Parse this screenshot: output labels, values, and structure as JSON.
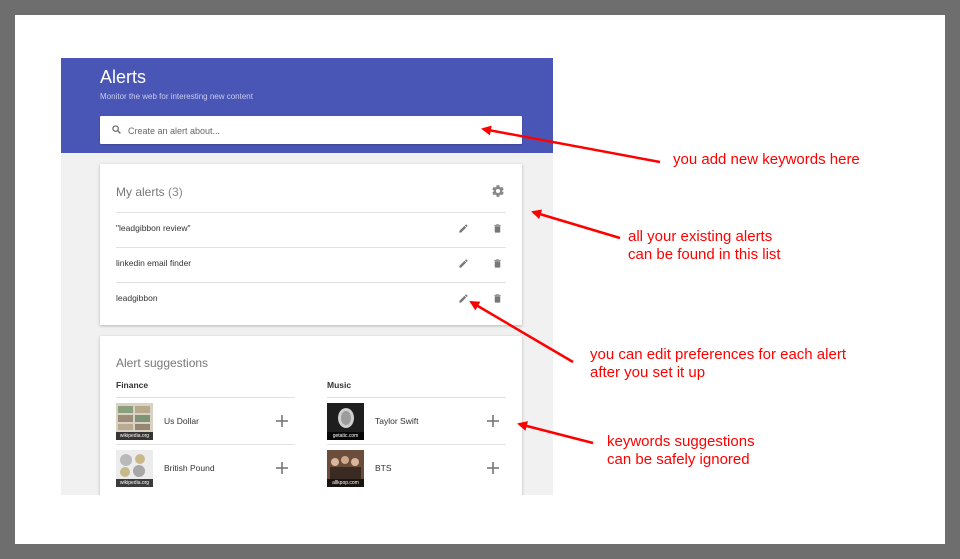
{
  "header": {
    "title": "Alerts",
    "subtitle": "Monitor the web for interesting new content"
  },
  "search": {
    "placeholder": "Create an alert about..."
  },
  "my_alerts": {
    "title": "My alerts",
    "count": "(3)",
    "items": [
      {
        "label": "\"leadgibbon review\""
      },
      {
        "label": "linkedin email finder"
      },
      {
        "label": "leadgibbon"
      }
    ]
  },
  "suggestions": {
    "title": "Alert suggestions",
    "columns": [
      {
        "title": "Finance",
        "items": [
          {
            "name": "Us Dollar",
            "source": "wikipedia.org"
          },
          {
            "name": "British Pound",
            "source": "wikipedia.org"
          }
        ]
      },
      {
        "title": "Music",
        "items": [
          {
            "name": "Taylor Swift",
            "source": "getatic.com"
          },
          {
            "name": "BTS",
            "source": "allkpop.com"
          }
        ]
      }
    ]
  },
  "annotations": {
    "a1": "you add new keywords here",
    "a2_line1": "all your existing alerts",
    "a2_line2": "can be found in this list",
    "a3_line1": "you can edit preferences for each alert",
    "a3_line2": "after you set it up",
    "a4_line1": "keywords suggestions",
    "a4_line2": "can be safely ignored"
  },
  "colors": {
    "header": "#4a56b5",
    "annotation": "#ff0000"
  }
}
